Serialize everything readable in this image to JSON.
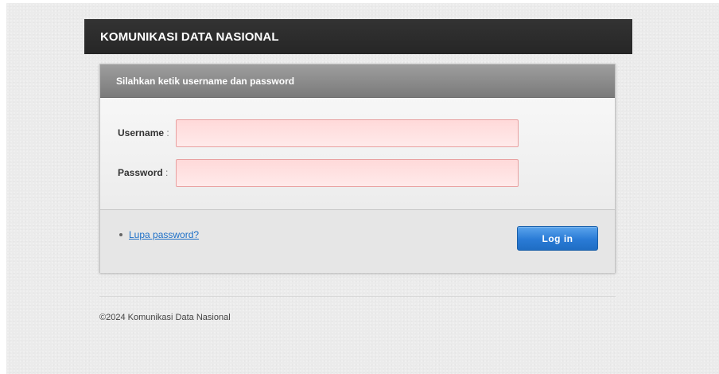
{
  "header": {
    "title": "KOMUNIKASI DATA NASIONAL"
  },
  "login": {
    "prompt": "Silahkan ketik username dan password",
    "username_label": "Username",
    "username_value": "",
    "password_label": "Password",
    "password_value": "",
    "colon": ":",
    "forgot_label": "Lupa password?",
    "submit_label": "Log in"
  },
  "footer": {
    "copyright": "©2024 Komunikasi Data Nasional"
  },
  "colors": {
    "header_bg": "#2e2e2e",
    "panel_header_bg": "#8a8a8a",
    "input_bg": "#ffe0e0",
    "input_border": "#e8a0a0",
    "button_bg": "#2a7bd6",
    "link": "#1c6fc7"
  }
}
